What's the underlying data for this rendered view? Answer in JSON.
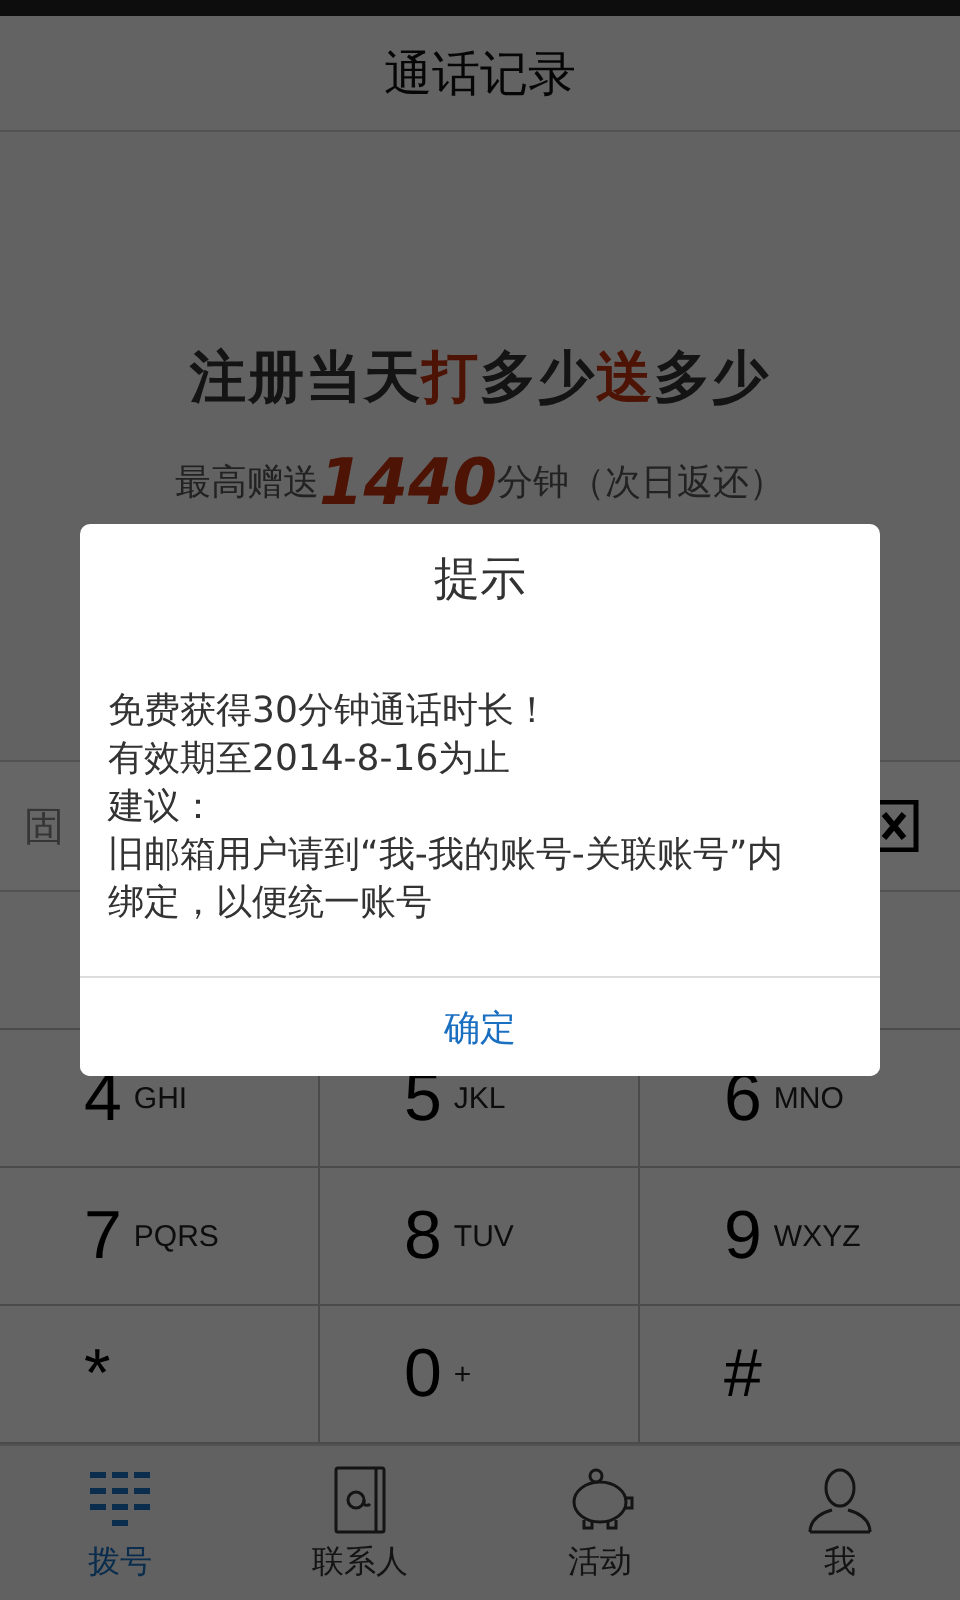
{
  "header": {
    "title": "通话记录"
  },
  "promo": {
    "headline": [
      {
        "text": "注册当天",
        "highlight": false
      },
      {
        "text": "打",
        "highlight": true
      },
      {
        "text": "多少",
        "highlight": false
      },
      {
        "text": "送",
        "highlight": true
      },
      {
        "text": "多少",
        "highlight": false
      }
    ],
    "subline": [
      {
        "text": "最高赠送",
        "highlight": false
      },
      {
        "text": "1440",
        "highlight": true
      },
      {
        "text": "分钟（次日返还）",
        "highlight": false
      }
    ]
  },
  "number_field": {
    "placeholder": "固"
  },
  "keypad": [
    {
      "digit": "4",
      "letters": "GHI"
    },
    {
      "digit": "5",
      "letters": "JKL"
    },
    {
      "digit": "6",
      "letters": "MNO"
    },
    {
      "digit": "7",
      "letters": "PQRS"
    },
    {
      "digit": "8",
      "letters": "TUV"
    },
    {
      "digit": "9",
      "letters": "WXYZ"
    },
    {
      "digit": "*"
    },
    {
      "digit": "0",
      "letters": "+"
    },
    {
      "digit": "#"
    }
  ],
  "tabs": [
    {
      "label": "拨号",
      "kind": "dialpad",
      "selected": true
    },
    {
      "label": "联系人",
      "kind": "contacts",
      "selected": false
    },
    {
      "label": "活动",
      "kind": "piggy",
      "selected": false
    },
    {
      "label": "我",
      "kind": "person",
      "selected": false
    }
  ],
  "dialog": {
    "title": "提示",
    "lines": [
      "免费获得30分钟通话时长！",
      "有效期至2014-8-16为止",
      "建议：",
      "旧邮箱用户请到“我-我的账号-关联账号”内绑定，以便统一账号"
    ],
    "button": "确定"
  }
}
